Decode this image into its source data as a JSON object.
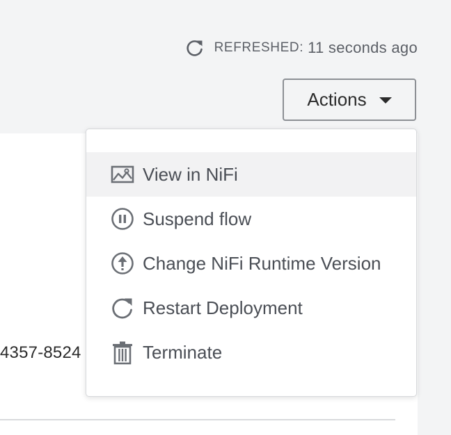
{
  "header": {
    "refreshed_label": "REFRESHED:",
    "refreshed_value": "11 seconds ago",
    "refresh_icon": "refresh-icon"
  },
  "actions": {
    "label": "Actions"
  },
  "menu": {
    "items": [
      {
        "label": "View in NiFi",
        "icon": "image-icon"
      },
      {
        "label": "Suspend flow",
        "icon": "pause-circle-icon"
      },
      {
        "label": "Change NiFi Runtime Version",
        "icon": "upload-circle-icon"
      },
      {
        "label": "Restart Deployment",
        "icon": "restart-icon"
      },
      {
        "label": "Terminate",
        "icon": "trash-icon"
      }
    ]
  },
  "content": {
    "id_fragment": "4357-8524"
  },
  "colors": {
    "background": "#f3f4f5",
    "text": "#2b2b2b",
    "menu_text": "#4a4e55",
    "icon": "#6b6f75",
    "hover_background": "#f2f2f3"
  }
}
